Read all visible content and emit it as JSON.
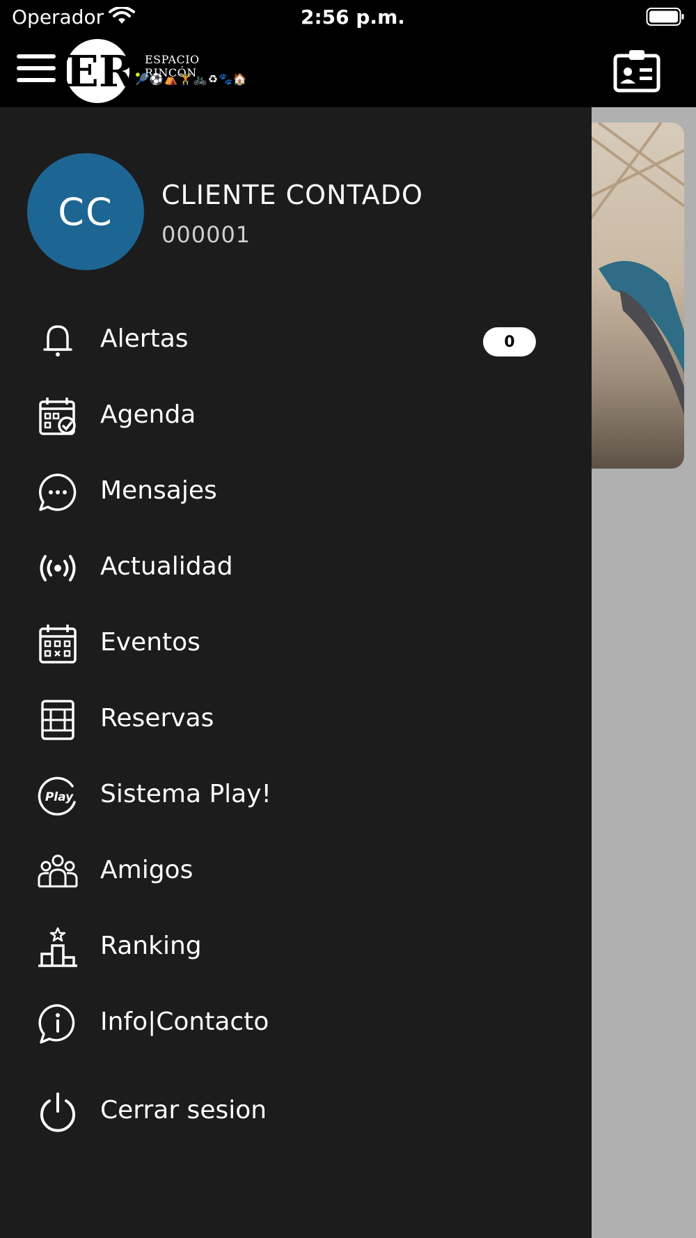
{
  "status_bar": {
    "carrier": "Operador",
    "time": "2:56 p.m."
  },
  "header": {
    "brand_monogram": "ER",
    "brand_name": "ESPACIO RINCÓN",
    "brand_icons": "🎾⚽⛺🏋🚲♻🐾🏠"
  },
  "user": {
    "initials": "CC",
    "name": "CLIENTE CONTADO",
    "id": "000001"
  },
  "menu": {
    "items": [
      {
        "label": "Alertas",
        "icon": "bell-icon",
        "badge": "0"
      },
      {
        "label": "Agenda",
        "icon": "calendar-check-icon"
      },
      {
        "label": "Mensajes",
        "icon": "chat-bubble-icon"
      },
      {
        "label": "Actualidad",
        "icon": "broadcast-icon"
      },
      {
        "label": "Eventos",
        "icon": "calendar-grid-icon"
      },
      {
        "label": "Reservas",
        "icon": "court-icon"
      },
      {
        "label": "Sistema Play!",
        "icon": "play-logo-icon"
      },
      {
        "label": "Amigos",
        "icon": "group-icon"
      },
      {
        "label": "Ranking",
        "icon": "podium-icon"
      },
      {
        "label": "Info|Contacto",
        "icon": "info-chat-icon"
      },
      {
        "label": "Cerrar sesion",
        "icon": "power-icon"
      }
    ]
  },
  "colors": {
    "drawer_bg": "#1c1c1d",
    "avatar_bg": "#1d6694",
    "overlay_bg": "#b0b0b0"
  }
}
